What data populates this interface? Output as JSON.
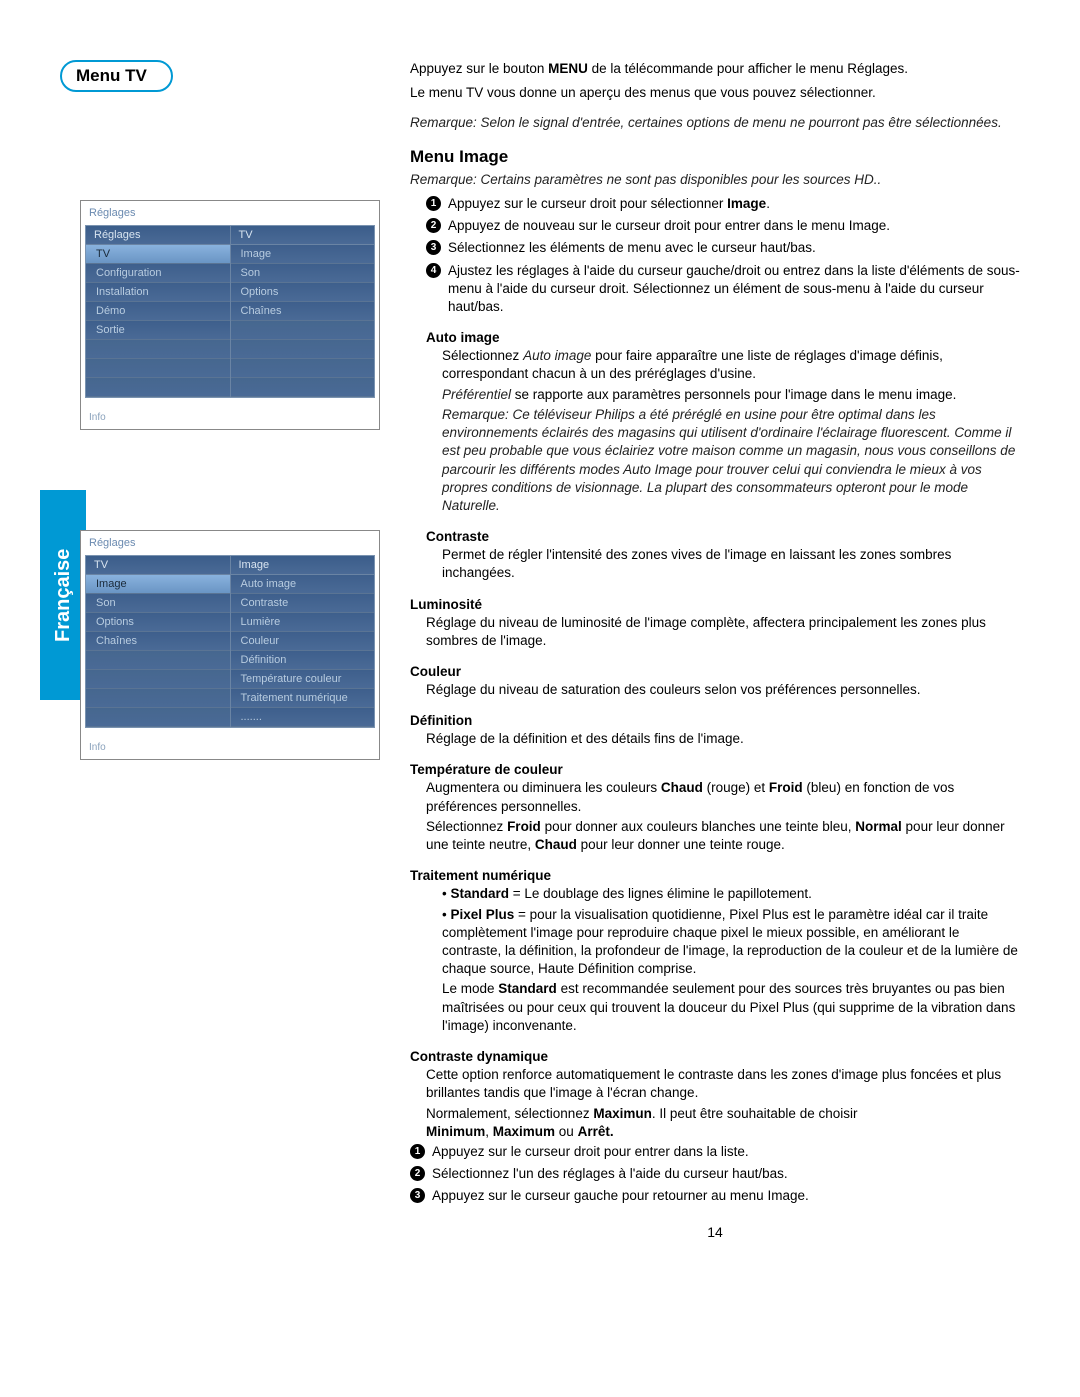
{
  "lang_tab": "Française",
  "title_pill": "Menu TV",
  "page_number": "14",
  "intro": {
    "line1a": "Appuyez sur le bouton ",
    "line1b": "MENU",
    "line1c": " de la télécommande pour afficher le menu Réglages.",
    "line2": "Le menu TV vous donne un aperçu des menus que vous pouvez sélectionner.",
    "remark": "Remarque: Selon le signal d'entrée, certaines options de menu ne pourront pas être sélectionnées."
  },
  "menu_image": {
    "heading": "Menu Image",
    "remark": "Remarque: Certains paramètres ne sont pas disponibles pour les sources HD..",
    "steps": [
      {
        "pre": "Appuyez sur le curseur droit pour sélectionner ",
        "bold": "Image",
        "post": "."
      },
      {
        "pre": "Appuyez de nouveau sur le curseur droit pour entrer dans le menu Image.",
        "bold": "",
        "post": ""
      },
      {
        "pre": "Sélectionnez les éléments de menu avec le curseur haut/bas.",
        "bold": "",
        "post": ""
      },
      {
        "pre": "Ajustez les réglages à l'aide du curseur gauche/droit ou entrez dans la liste d'éléments de sous-menu à l'aide du curseur droit. Sélectionnez un élément de sous-menu à l'aide du curseur haut/bas.",
        "bold": "",
        "post": ""
      }
    ]
  },
  "auto_image": {
    "heading": "Auto image",
    "p1a": "Sélectionnez ",
    "p1b": "Auto image",
    "p1c": " pour faire apparaître une liste de réglages d'image définis, correspondant chacun à un des préréglages d'usine.",
    "p2a": "Préférentiel",
    "p2b": " se rapporte aux paramètres personnels pour l'image dans le menu image.",
    "remark_a": "Remarque: Ce téléviseur Philips a été préréglé en usine pour être optimal dans les environnements éclairés des magasins qui utilisent d'ordinaire l'éclairage fluorescent. Comme il est peu probable que vous éclairiez votre maison comme un magasin, nous vous conseillons de parcourir  les différents modes Auto Image pour trouver celui qui conviendra le mieux à vos propres conditions de visionnage. La plupart des consommateurs opteront pour le mode ",
    "remark_b": "Naturelle",
    "remark_c": "."
  },
  "contraste": {
    "heading": "Contraste",
    "body": "Permet de régler l'intensité des zones vives de l'image en laissant les zones sombres inchangées."
  },
  "luminosite": {
    "heading": "Luminosité",
    "body": "Réglage du niveau de luminosité de l'image complète, affectera principalement les zones plus sombres de l'image."
  },
  "couleur": {
    "heading": "Couleur",
    "body": "Réglage du niveau de saturation des couleurs selon vos préférences personnelles."
  },
  "definition": {
    "heading": "Définition",
    "body": "Réglage de la définition et des détails fins de l'image."
  },
  "temp": {
    "heading": "Température de couleur",
    "p1a": "Augmentera ou diminuera les couleurs ",
    "p1b": "Chaud",
    "p1c": " (rouge) et ",
    "p1d": "Froid",
    "p1e": " (bleu) en fonction de vos préférences personnelles.",
    "p2a": "Sélectionnez ",
    "p2b": "Froid",
    "p2c": " pour donner aux couleurs blanches une teinte bleu, ",
    "p2d": "Normal",
    "p2e": " pour leur donner une teinte neutre, ",
    "p2f": "Chaud",
    "p2g": " pour leur donner une teinte rouge."
  },
  "traitement": {
    "heading": "Traitement numérique",
    "b1a": "Standard",
    "b1b": " = Le doublage des lignes élimine le papillotement.",
    "b2a": "Pixel Plus",
    "b2b": " = pour la visualisation quotidienne, Pixel Plus est le paramètre idéal car il traite complètement l'image pour reproduire chaque pixel le mieux possible, en améliorant le contraste, la définition, la profondeur de l'image, la reproduction de la couleur et de la lumière de chaque source, Haute Définition comprise.",
    "p3a": "Le mode ",
    "p3b": "Standard",
    "p3c": " est recommandée seulement pour des sources très bruyantes ou pas bien maîtrisées ou pour ceux qui trouvent la douceur du Pixel Plus (qui supprime de la vibration dans l'image) inconvenante."
  },
  "dyn": {
    "heading": "Contraste dynamique",
    "p1": "Cette option renforce automatiquement le contraste dans les zones d'image plus foncées et plus brillantes tandis que l'image à l'écran change.",
    "p2a": "Normalement, sélectionnez ",
    "p2b": "Maximun",
    "p2c": ". Il peut être souhaitable de choisir ",
    "p2d": "Minimum",
    "p2e": ", ",
    "p2f": "Maximum",
    "p2g": " ou ",
    "p2h": "Arrêt.",
    "steps": [
      "Appuyez sur le curseur droit pour entrer dans la liste.",
      "Sélectionnez l'un des réglages à l'aide du curseur haut/bas.",
      "Appuyez sur le curseur gauche pour retourner au menu Image."
    ]
  },
  "ss1": {
    "title": "Réglages",
    "info": "Info",
    "col1_header": "Réglages",
    "col1": [
      "TV",
      "Configuration",
      "Installation",
      "Démo",
      "Sortie"
    ],
    "col2_header": "TV",
    "col2": [
      "Image",
      "Son",
      "Options",
      "Chaînes"
    ]
  },
  "ss2": {
    "title": "Réglages",
    "info": "Info",
    "col1_header": "TV",
    "col1": [
      "Image",
      "Son",
      "Options",
      "Chaînes"
    ],
    "col2_header": "Image",
    "col2": [
      "Auto image",
      "Contraste",
      "Lumière",
      "Couleur",
      "Définition",
      "Température couleur",
      "Traitement numérique",
      "......."
    ]
  }
}
